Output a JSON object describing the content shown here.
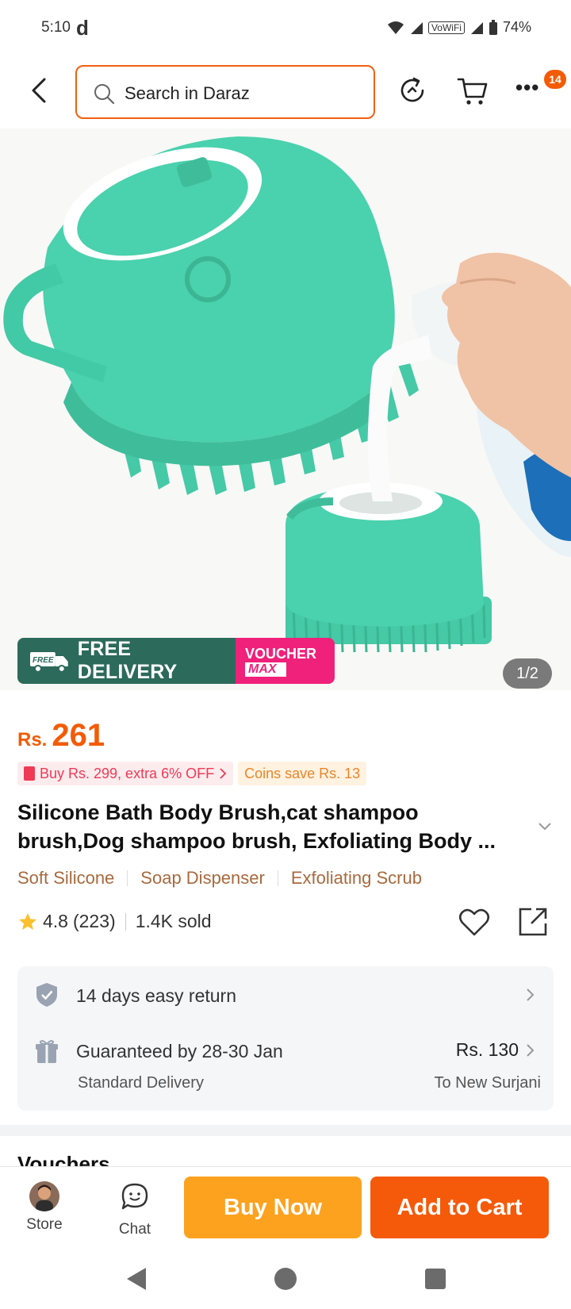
{
  "status_bar": {
    "time": "5:10",
    "app_indicator": "d",
    "network": "VoWiFi",
    "battery": "74%"
  },
  "header": {
    "search_placeholder": "Search in Daraz",
    "more_badge": "14"
  },
  "hero": {
    "free_delivery": "FREE DELIVERY",
    "free_badge": "FREE",
    "voucher_top": "VOUCHER",
    "voucher_bottom": "MAX",
    "page_indicator": "1/2"
  },
  "product": {
    "price_currency": "Rs.",
    "price_value": "261",
    "promo_buy": "Buy Rs. 299, extra 6% OFF",
    "promo_coins": "Coins save Rs. 13",
    "title_line1": "Silicone Bath Body Brush,cat shampoo",
    "title_line2": "brush,Dog shampoo brush, Exfoliating Body ...",
    "features": [
      "Soft Silicone",
      "Soap Dispenser",
      "Exfoliating Scrub"
    ],
    "rating": "4.8",
    "reviews": "(223)",
    "sold": "1.4K sold"
  },
  "services": {
    "return_text": "14 days easy return",
    "delivery_text": "Guaranteed by 28-30 Jan",
    "delivery_price": "Rs. 130",
    "delivery_type": "Standard Delivery",
    "delivery_dest": "To New Surjani"
  },
  "next_section_peek": "Vouchers",
  "bottom_bar": {
    "store_label": "Store",
    "chat_label": "Chat",
    "buy_now": "Buy Now",
    "add_to_cart": "Add to Cart"
  },
  "colors": {
    "accent": "#f55a0a",
    "buy_now": "#fca21f",
    "free_delivery_bg": "#2c6a5b",
    "voucher_bg": "#f0217a",
    "product_teal": "#4ad1ae"
  },
  "icons": [
    "back-icon",
    "search-icon",
    "history-icon",
    "cart-icon",
    "more-icon",
    "star-icon",
    "heart-icon",
    "share-icon",
    "shield-check-icon",
    "gift-icon",
    "chevron-right-icon",
    "chat-icon"
  ]
}
